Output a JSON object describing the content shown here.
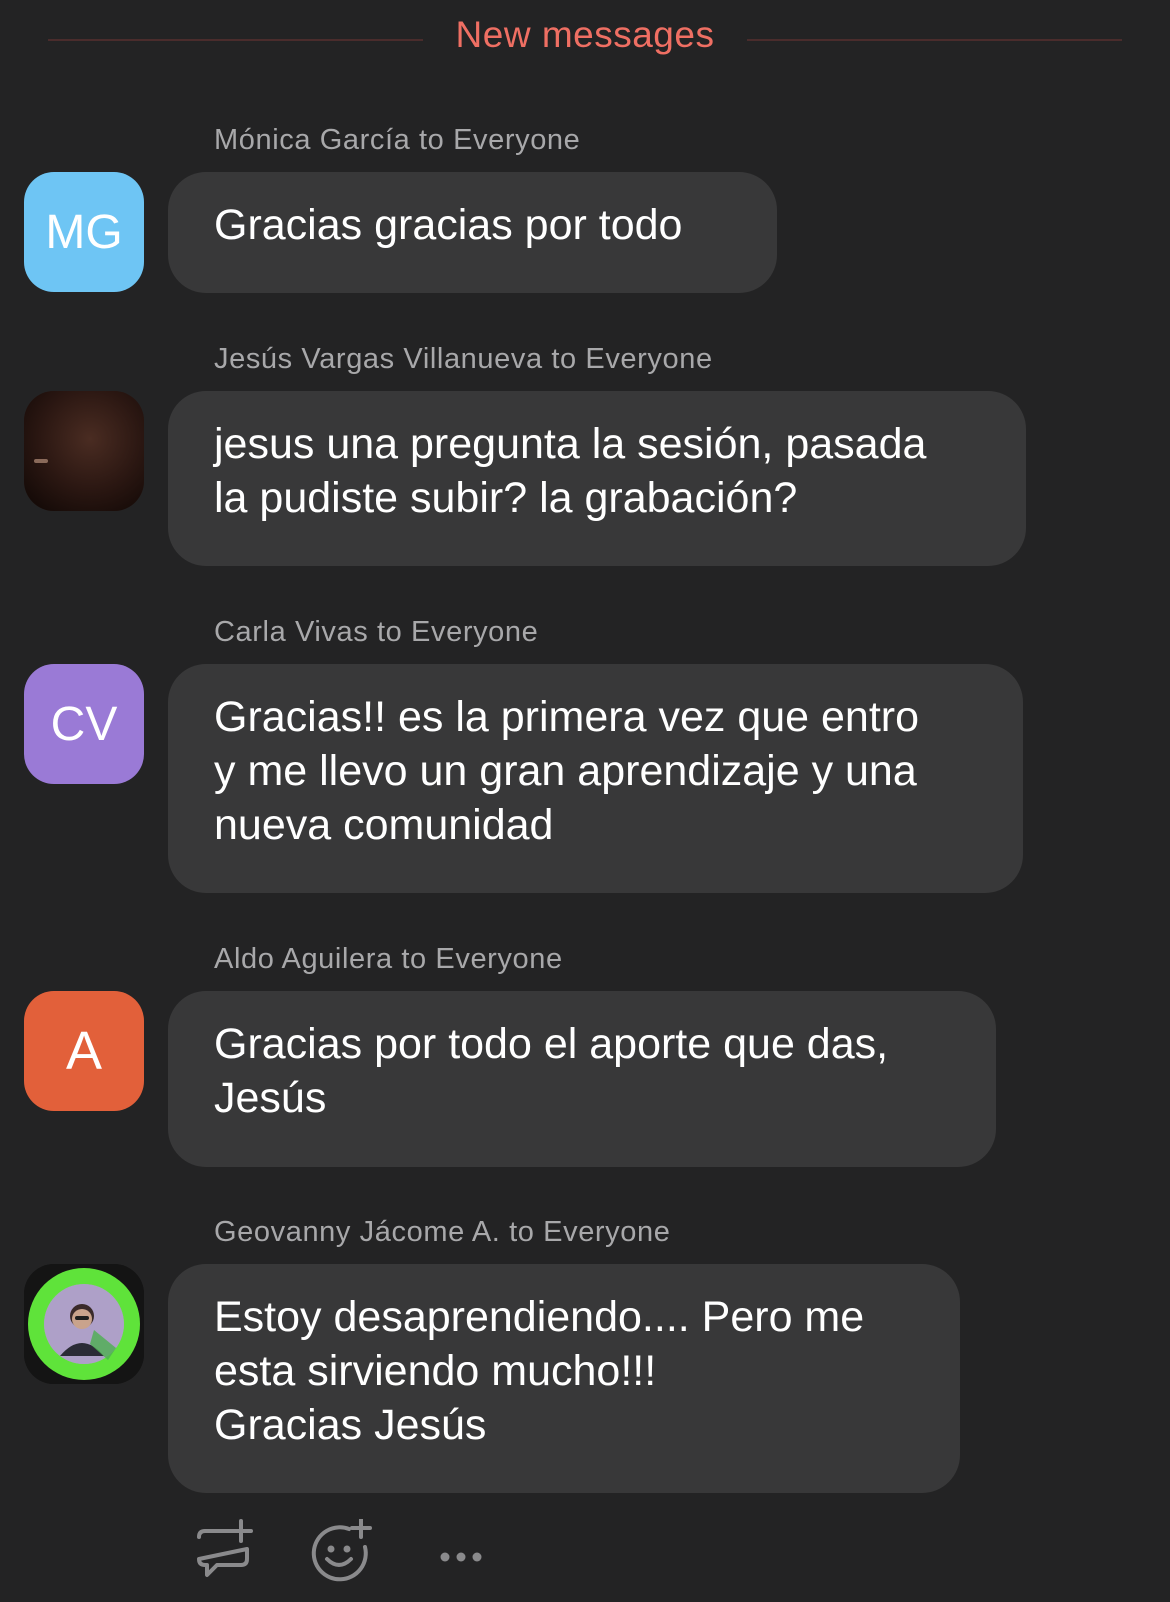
{
  "divider": {
    "label": "New messages"
  },
  "colors": {
    "background": "#232324",
    "bubble": "#383839",
    "divider_text": "#ef6f63",
    "sender_text": "#a8a8aa"
  },
  "messages": [
    {
      "sender": "Mónica García to Everyone",
      "avatar_initials": "MG",
      "avatar_color": "#6ec5f4",
      "text": "Gracias gracias por todo"
    },
    {
      "sender": "Jesús Vargas Villanueva to Everyone",
      "avatar_initials": "",
      "avatar_color": "#2a1a16",
      "avatar_type": "photo-dark",
      "text": "jesus una pregunta la sesión, pasada\nla pudiste subir? la grabación?"
    },
    {
      "sender": "Carla Vivas to Everyone",
      "avatar_initials": "CV",
      "avatar_color": "#9a7ad6",
      "text": "Gracias!! es la primera vez que entro\ny me llevo un gran aprendizaje y una\nnueva comunidad"
    },
    {
      "sender": "Aldo Aguilera to Everyone",
      "avatar_initials": "A",
      "avatar_color": "#e2603a",
      "text": "Gracias por todo el aporte que das,\nJesús"
    },
    {
      "sender": "Geovanny Jácome A. to Everyone",
      "avatar_initials": "",
      "avatar_color": "#5fe33a",
      "avatar_type": "photo-green-ring",
      "text": "Estoy desaprendiendo.... Pero me\nesta sirviendo mucho!!!\nGracias Jesús"
    }
  ],
  "actions": [
    {
      "name": "reply-in-thread",
      "icon": "chat-bubble-plus-icon"
    },
    {
      "name": "add-reaction",
      "icon": "smiley-plus-icon"
    },
    {
      "name": "more-options",
      "icon": "ellipsis-icon"
    }
  ]
}
